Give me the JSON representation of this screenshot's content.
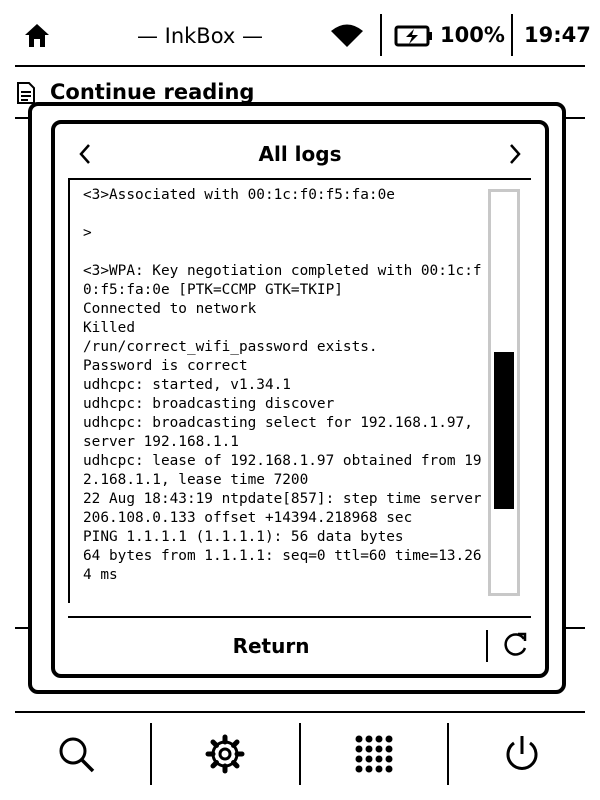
{
  "status_bar": {
    "device_name": "— InkBox —",
    "battery": "100%",
    "time": "19:47"
  },
  "background": {
    "section_title": "Continue reading"
  },
  "dialog": {
    "title": "All logs",
    "return_label": "Return",
    "log_text": "<3>Associated with 00:1c:f0:f5:fa:0e\n\n>\n\n<3>WPA: Key negotiation completed with 00:1c:f0:f5:fa:0e [PTK=CCMP GTK=TKIP]\nConnected to network\nKilled\n/run/correct_wifi_password exists.\nPassword is correct\nudhcpc: started, v1.34.1\nudhcpc: broadcasting discover\nudhcpc: broadcasting select for 192.168.1.97, server 192.168.1.1\nudhcpc: lease of 192.168.1.97 obtained from 192.168.1.1, lease time 7200\n22 Aug 18:43:19 ntpdate[857]: step time server 206.108.0.133 offset +14394.218968 sec\nPING 1.1.1.1 (1.1.1.1): 56 data bytes\n64 bytes from 1.1.1.1: seq=0 ttl=60 time=13.264 ms",
    "scroll_position": 0.4,
    "scroll_visible_fraction": 0.39
  },
  "icons": {
    "home": "home-icon",
    "wifi": "wifi-icon",
    "battery": "battery-charging-icon",
    "prev": "chevron-left-icon",
    "next": "chevron-right-icon",
    "refresh": "refresh-icon",
    "search": "search-icon",
    "settings": "gear-icon",
    "apps": "apps-grid-icon",
    "power": "power-icon"
  }
}
